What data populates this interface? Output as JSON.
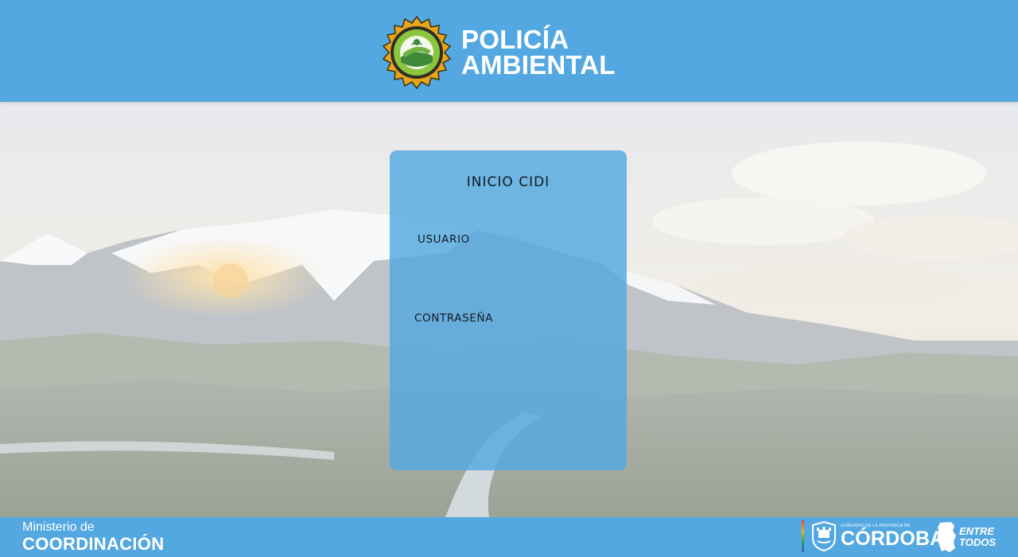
{
  "header": {
    "logo_icon": "policia-ambiental-seal-icon",
    "brand_line1": "POLICÍA",
    "brand_line2": "AMBIENTAL"
  },
  "login": {
    "title": "INICIO CIDI",
    "username_label": "USUARIO",
    "username_value": "",
    "password_label": "CONTRASEÑA",
    "password_value": ""
  },
  "footer": {
    "ministry_line1": "Ministerio de",
    "ministry_line2": "COORDINACIÓN",
    "gov_icon": "cordoba-shield-icon",
    "gov_small": "GOBIERNO DE LA PROVINCIA DE",
    "gov_name": "CÓRDOBA",
    "slogan_icon": "cordoba-map-icon",
    "slogan_line1": "ENTRE",
    "slogan_line2": "TODOS"
  },
  "colors": {
    "primary_blue": "#53a8e1",
    "card_blue": "#5cabe0",
    "text_dark": "#111a22"
  }
}
